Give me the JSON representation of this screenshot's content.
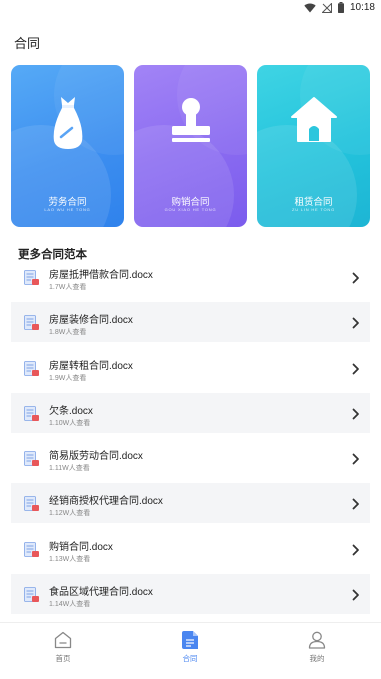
{
  "status_bar": {
    "time": "10:18",
    "icons": [
      "wifi-icon",
      "signal-off-icon",
      "battery-icon"
    ]
  },
  "page_title": "合同",
  "cards": [
    {
      "label": "劳务合同",
      "sub": "LAO WU HE TONG",
      "icon": "money-bag-icon"
    },
    {
      "label": "购销合同",
      "sub": "GOU XIAO HE TONG",
      "icon": "stamp-icon"
    },
    {
      "label": "租赁合同",
      "sub": "ZU LIN HE TONG",
      "icon": "house-icon"
    }
  ],
  "section_title": "更多合同范本",
  "list": [
    {
      "title": "房屋抵押借款合同.docx",
      "views": "1.7W人查看"
    },
    {
      "title": "房屋装修合同.docx",
      "views": "1.8W人查看"
    },
    {
      "title": "房屋转租合同.docx",
      "views": "1.9W人查看"
    },
    {
      "title": "欠条.docx",
      "views": "1.10W人查看"
    },
    {
      "title": "简易版劳动合同.docx",
      "views": "1.11W人查看"
    },
    {
      "title": "经销商授权代理合同.docx",
      "views": "1.12W人查看"
    },
    {
      "title": "购销合同.docx",
      "views": "1.13W人查看"
    },
    {
      "title": "食品区域代理合同.docx",
      "views": "1.14W人查看"
    }
  ],
  "nav": {
    "home": "首页",
    "contract": "合同",
    "mine": "我的"
  },
  "colors": {
    "card1": "#3d8ff0",
    "card2": "#8a6bf1",
    "card3": "#23c3dc",
    "accent": "#4a86f0",
    "row_shade": "#f4f5f7"
  }
}
